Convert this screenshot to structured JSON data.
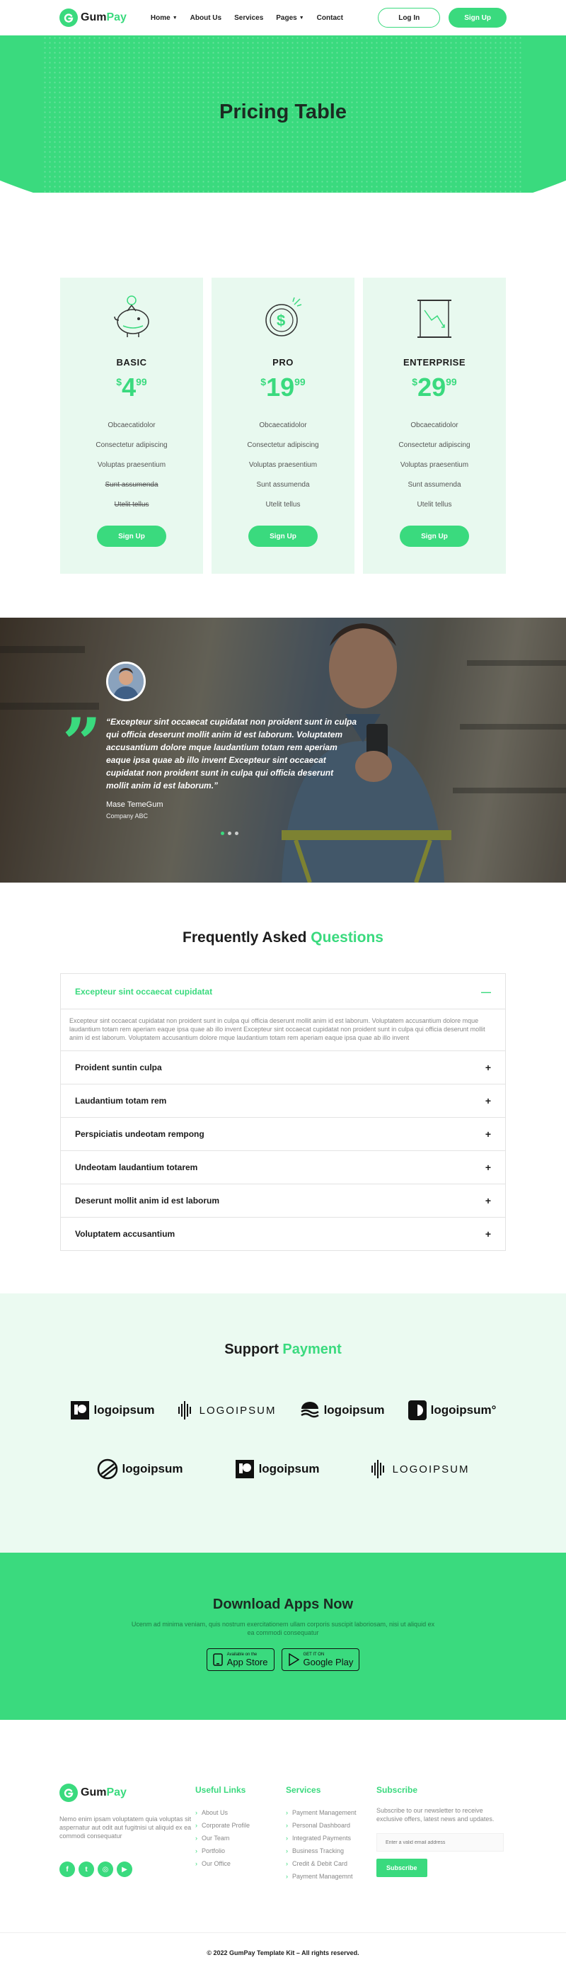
{
  "brand": {
    "gum": "Gum",
    "pay": "Pay"
  },
  "nav": [
    {
      "label": "Home",
      "dropdown": true
    },
    {
      "label": "About Us",
      "dropdown": false
    },
    {
      "label": "Services",
      "dropdown": false
    },
    {
      "label": "Pages",
      "dropdown": true
    },
    {
      "label": "Contact",
      "dropdown": false
    }
  ],
  "header": {
    "login": "Log In",
    "signup": "Sign Up"
  },
  "hero": {
    "title": "Pricing Table"
  },
  "pricing": [
    {
      "name": "BASIC",
      "currency": "$",
      "amount": "4",
      "cents": "99",
      "icon": "piggy-bank-icon",
      "features": [
        {
          "text": "Obcaecatidolor",
          "strike": false
        },
        {
          "text": "Consectetur adipiscing",
          "strike": false
        },
        {
          "text": "Voluptas praesentium",
          "strike": false
        },
        {
          "text": "Sunt assumenda",
          "strike": true
        },
        {
          "text": " Utelit tellus",
          "strike": true
        }
      ],
      "button": "Sign Up"
    },
    {
      "name": "PRO",
      "currency": "$",
      "amount": "19",
      "cents": "99",
      "icon": "coin-dollar-icon",
      "features": [
        {
          "text": "Obcaecatidolor",
          "strike": false
        },
        {
          "text": "Consectetur adipiscing",
          "strike": false
        },
        {
          "text": "Voluptas praesentium",
          "strike": false
        },
        {
          "text": "Sunt assumenda",
          "strike": false
        },
        {
          "text": "Utelit tellus",
          "strike": false
        }
      ],
      "button": "Sign Up"
    },
    {
      "name": "ENTERPRISE",
      "currency": "$",
      "amount": "29",
      "cents": "99",
      "icon": "chart-board-icon",
      "features": [
        {
          "text": "Obcaecatidolor",
          "strike": false
        },
        {
          "text": "Consectetur adipiscing",
          "strike": false
        },
        {
          "text": "Voluptas praesentium",
          "strike": false
        },
        {
          "text": "Sunt assumenda",
          "strike": false
        },
        {
          "text": "Utelit tellus",
          "strike": false
        }
      ],
      "button": "Sign Up"
    }
  ],
  "testimonial": {
    "quote": "“Excepteur sint occaecat cupidatat non proident sunt in culpa qui officia deserunt mollit anim id est laborum. Voluptatem accusantium dolore mque laudantium totam rem aperiam eaque ipsa quae ab illo invent Excepteur sint occaecat cupidatat non proident sunt in culpa qui officia deserunt mollit anim id est laborum.”",
    "name": "Mase TemeGum",
    "company": "Company ABC",
    "slides": 3,
    "active_slide": 1
  },
  "faq": {
    "title_a": "Frequently Asked ",
    "title_b": "Questions",
    "open_question": "Excepteur sint occaecat cupidatat",
    "open_answer": "Excepteur sint occaecat cupidatat non proident sunt in culpa qui officia deserunt mollit anim id est laborum. Voluptatem accusantium dolore mque laudantium totam rem aperiam eaque ipsa quae ab illo invent Excepteur sint occaecat cupidatat non proident sunt in culpa qui officia deserunt mollit anim id est laborum. Voluptatem accusantium dolore mque laudantium totam rem aperiam eaque ipsa quae ab illo invent",
    "questions": [
      "Proident suntin culpa",
      "Laudantium totam rem",
      "Perspiciatis undeotam rempong",
      "Undeotam laudantium totarem",
      "Deserunt mollit anim id est laborum",
      "Voluptatem accusantium"
    ]
  },
  "support": {
    "title_a": "Support ",
    "title_b": "Payment",
    "logos_row1": [
      "logoipsum",
      "LOGOIPSUM",
      "logoipsum",
      "logoipsum°"
    ],
    "logos_row2": [
      "logoipsum",
      "logoipsum",
      "LOGOIPSUM"
    ]
  },
  "download": {
    "title": "Download Apps Now",
    "text": "Ucenm ad minima veniam, quis nostrum exercitationem ullam corporis suscipit laboriosam, nisi ut aliquid ex ea commodi consequatur",
    "appstore_small": "Available on the",
    "appstore_big": "App Store",
    "google_small": "GET IT ON",
    "google_big": "Google Play"
  },
  "footer": {
    "about": "Nemo enim ipsam voluptatem quia voluptas sit aspernatur aut odit aut fugitnisi ut aliquid ex ea commodi consequatur",
    "useful_title": "Useful Links",
    "useful_links": [
      "About Us",
      "Corporate Profile",
      "Our Team",
      "Portfolio",
      "Our Office"
    ],
    "services_title": "Services",
    "services_links": [
      "Payment Management",
      "Personal Dashboard",
      "Integrated Payments",
      "Business Tracking",
      "Credit & Debit Card",
      "Payment Managemnt"
    ],
    "subscribe_title": "Subscribe",
    "subscribe_text": "Subscribe to our newsletter to receive exclusive offers, latest news and updates.",
    "email_placeholder": "Enter a valid email address",
    "subscribe_button": "Subscribe",
    "copyright": "© 2022 GumPay Template Kit – All rights reserved."
  },
  "colors": {
    "accent": "#3ada7e",
    "accent_light": "#e8f9ef",
    "text": "#1c1c1c"
  }
}
